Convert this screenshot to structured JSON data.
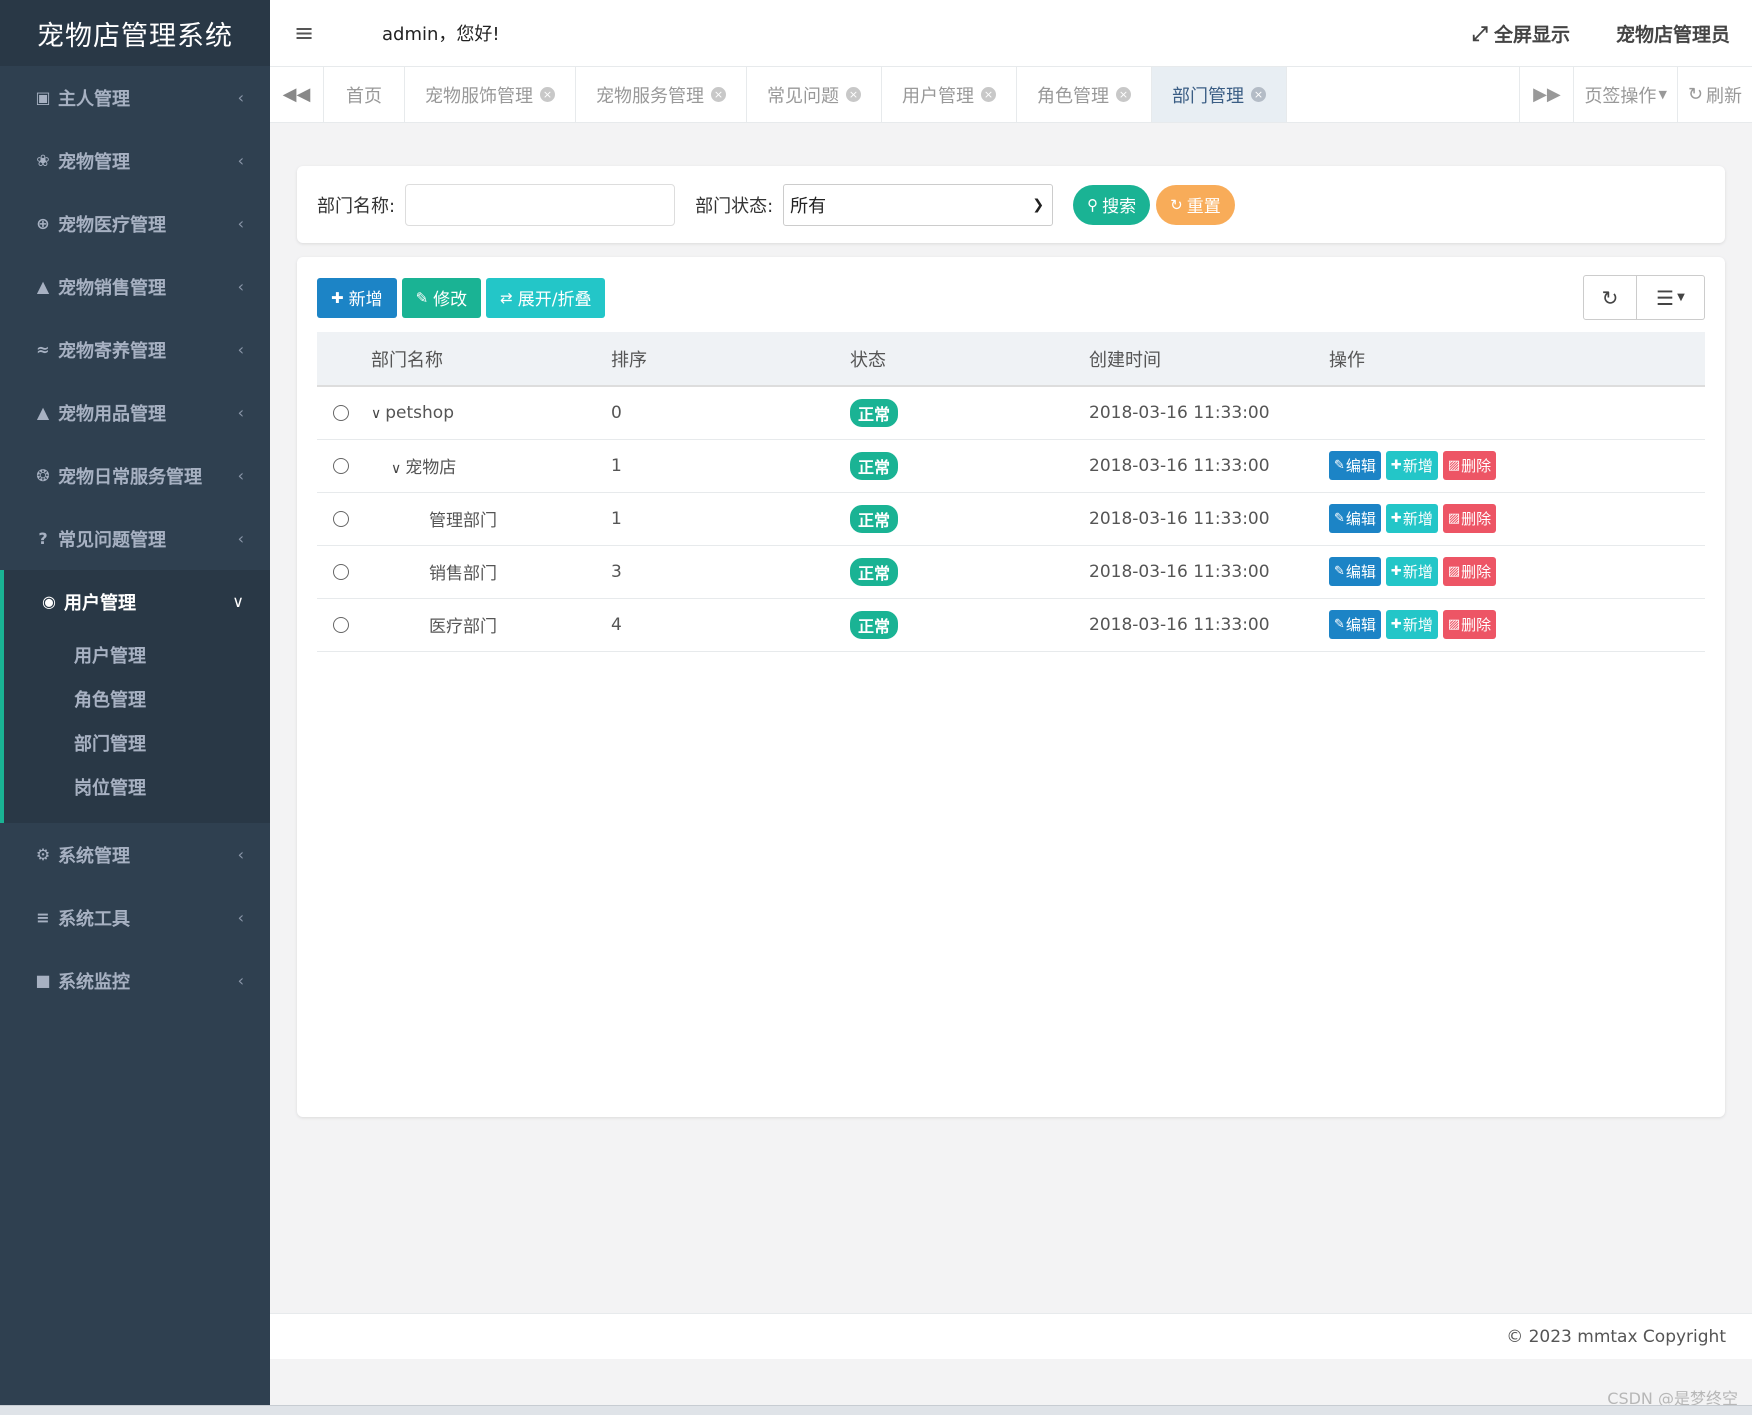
{
  "app": {
    "title": "宠物店管理系统"
  },
  "colors": {
    "sidebar": "#2f4050",
    "primary": "#1c84c6",
    "success": "#1ab394",
    "info": "#23c6c8",
    "warning": "#f8ac59",
    "danger": "#ed5565"
  },
  "sidebar": {
    "items": [
      {
        "label": "主人管理",
        "icon": "id-card-icon"
      },
      {
        "label": "宠物管理",
        "icon": "paw-icon"
      },
      {
        "label": "宠物医疗管理",
        "icon": "plus-circle-icon"
      },
      {
        "label": "宠物销售管理",
        "icon": "bell-icon"
      },
      {
        "label": "宠物寄养管理",
        "icon": "wifi-icon"
      },
      {
        "label": "宠物用品管理",
        "icon": "bell-icon"
      },
      {
        "label": "宠物日常服务管理",
        "icon": "soccer-ball-icon"
      },
      {
        "label": "常见问题管理",
        "icon": "question-circle-icon"
      },
      {
        "label": "用户管理",
        "icon": "user-circle-icon",
        "expanded": true,
        "children": [
          "用户管理",
          "角色管理",
          "部门管理",
          "岗位管理"
        ]
      },
      {
        "label": "系统管理",
        "icon": "gear-icon"
      },
      {
        "label": "系统工具",
        "icon": "bars-icon"
      },
      {
        "label": "系统监控",
        "icon": "video-camera-icon"
      }
    ]
  },
  "header": {
    "greeting": "admin，您好!",
    "fullscreen": "全屏显示",
    "role": "宠物店管理员"
  },
  "tabs": {
    "home": "首页",
    "items": [
      "宠物服饰管理",
      "宠物服务管理",
      "常见问题",
      "用户管理",
      "角色管理",
      "部门管理"
    ],
    "active": "部门管理",
    "tab_ops": "页签操作",
    "refresh": "刷新"
  },
  "search": {
    "dept_name_label": "部门名称:",
    "dept_name_value": "",
    "dept_status_label": "部门状态:",
    "dept_status_value": "所有",
    "search_btn": "搜索",
    "reset_btn": "重置"
  },
  "toolbar": {
    "add": "新增",
    "edit": "修改",
    "expand": "展开/折叠"
  },
  "table": {
    "columns": [
      "部门名称",
      "排序",
      "状态",
      "创建时间",
      "操作"
    ],
    "rows": [
      {
        "name": "petshop",
        "level": 0,
        "toggle": true,
        "order": "0",
        "status": "正常",
        "created": "2018-03-16 11:33:00",
        "actions": false
      },
      {
        "name": "宠物店",
        "level": 1,
        "toggle": true,
        "order": "1",
        "status": "正常",
        "created": "2018-03-16 11:33:00",
        "actions": true
      },
      {
        "name": "管理部门",
        "level": 2,
        "toggle": false,
        "order": "1",
        "status": "正常",
        "created": "2018-03-16 11:33:00",
        "actions": true
      },
      {
        "name": "销售部门",
        "level": 2,
        "toggle": false,
        "order": "3",
        "status": "正常",
        "created": "2018-03-16 11:33:00",
        "actions": true
      },
      {
        "name": "医疗部门",
        "level": 2,
        "toggle": false,
        "order": "4",
        "status": "正常",
        "created": "2018-03-16 11:33:00",
        "actions": true
      }
    ],
    "action_labels": {
      "edit": "编辑",
      "add": "新增",
      "delete": "删除"
    }
  },
  "footer": {
    "copyright": "© 2023 mmtax Copyright"
  },
  "watermark": "CSDN @是梦终空"
}
